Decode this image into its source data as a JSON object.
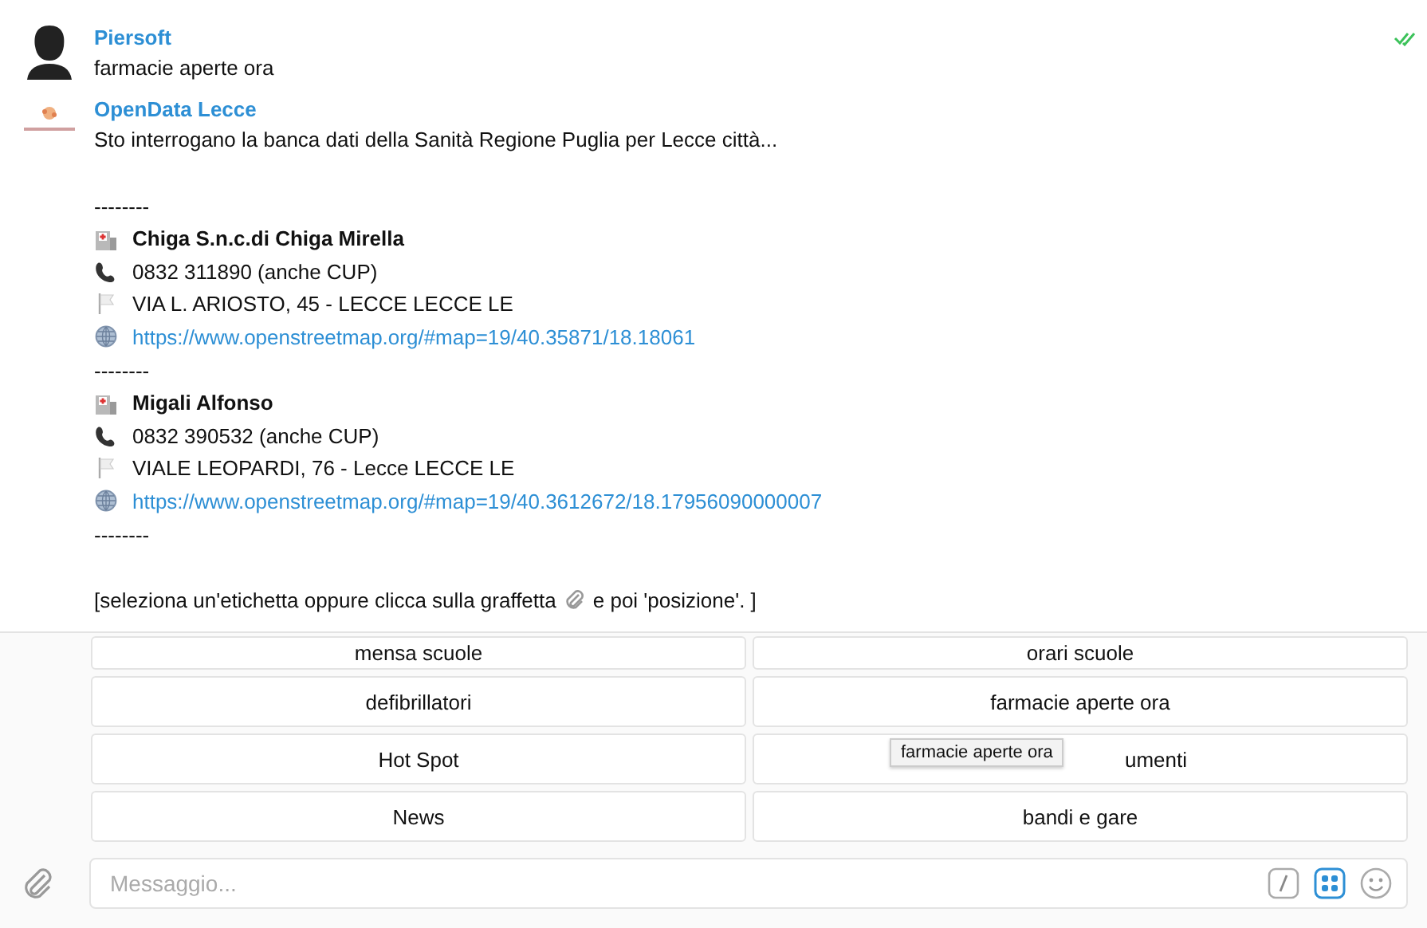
{
  "messages": [
    {
      "sender": "Piersoft",
      "kind": "person",
      "read": true,
      "lines": [
        {
          "kind": "plain",
          "text": "farmacie aperte ora"
        }
      ]
    },
    {
      "sender": "OpenData Lecce",
      "kind": "logo",
      "read": false,
      "lines": [
        {
          "kind": "plain",
          "text": "Sto interrogano la banca dati della Sanità Regione Puglia per Lecce città..."
        },
        {
          "kind": "blank"
        },
        {
          "kind": "plain",
          "text": "--------"
        },
        {
          "kind": "name",
          "text": "Chiga S.n.c.di Chiga Mirella"
        },
        {
          "kind": "phone",
          "text": "0832 311890 (anche CUP)"
        },
        {
          "kind": "address",
          "text": "VIA L. ARIOSTO, 45 - LECCE LECCE LE"
        },
        {
          "kind": "link",
          "text": "https://www.openstreetmap.org/#map=19/40.35871/18.18061"
        },
        {
          "kind": "plain",
          "text": "--------"
        },
        {
          "kind": "name",
          "text": "Migali Alfonso"
        },
        {
          "kind": "phone",
          "text": "0832 390532 (anche CUP)"
        },
        {
          "kind": "address",
          "text": "VIALE LEOPARDI, 76 - Lecce LECCE LE"
        },
        {
          "kind": "link",
          "text": "https://www.openstreetmap.org/#map=19/40.3612672/18.17956090000007"
        },
        {
          "kind": "plain",
          "text": "--------"
        },
        {
          "kind": "blank"
        },
        {
          "kind": "clip",
          "text": "[seleziona un'etichetta oppure clicca sulla graffetta",
          "after": "e poi 'posizione'. ]"
        }
      ]
    }
  ],
  "keyboard": [
    {
      "label": "mensa scuole"
    },
    {
      "label": "orari scuole"
    },
    {
      "label": "defibrillatori"
    },
    {
      "label": "farmacie aperte ora"
    },
    {
      "label": "Hot Spot"
    },
    {
      "label": "umenti",
      "tooltip": "farmacie aperte ora"
    },
    {
      "label": "News"
    },
    {
      "label": "bandi e gare"
    }
  ],
  "composer": {
    "placeholder": "Messaggio..."
  }
}
